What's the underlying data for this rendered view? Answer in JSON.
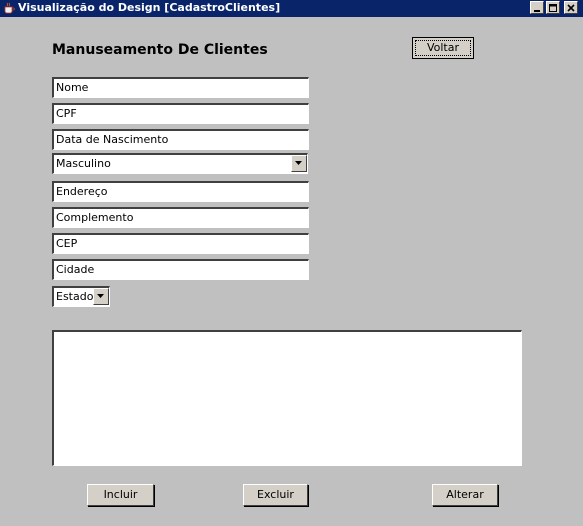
{
  "window": {
    "title": "Visualização do Design [CadastroClientes]"
  },
  "form": {
    "heading": "Manuseamento De Clientes",
    "voltar_label": "Voltar",
    "fields": {
      "nome": "Nome",
      "cpf": "CPF",
      "data_nascimento": "Data de Nascimento",
      "sexo": "Masculino",
      "endereco": "Endereço",
      "complemento": "Complemento",
      "cep": "CEP",
      "cidade": "Cidade",
      "estado": "Estado"
    },
    "textarea_value": "",
    "buttons": {
      "incluir": "Incluir",
      "excluir": "Excluir",
      "alterar": "Alterar"
    }
  },
  "icons": {
    "app": "java-cup-icon",
    "minimize": "minimize-icon",
    "maximize": "maximize-icon",
    "close": "close-icon",
    "dropdown": "chevron-down-icon"
  },
  "colors": {
    "titlebar": "#0a246a",
    "window_bg": "#c0c0c0",
    "button_face": "#d4d0c8"
  }
}
